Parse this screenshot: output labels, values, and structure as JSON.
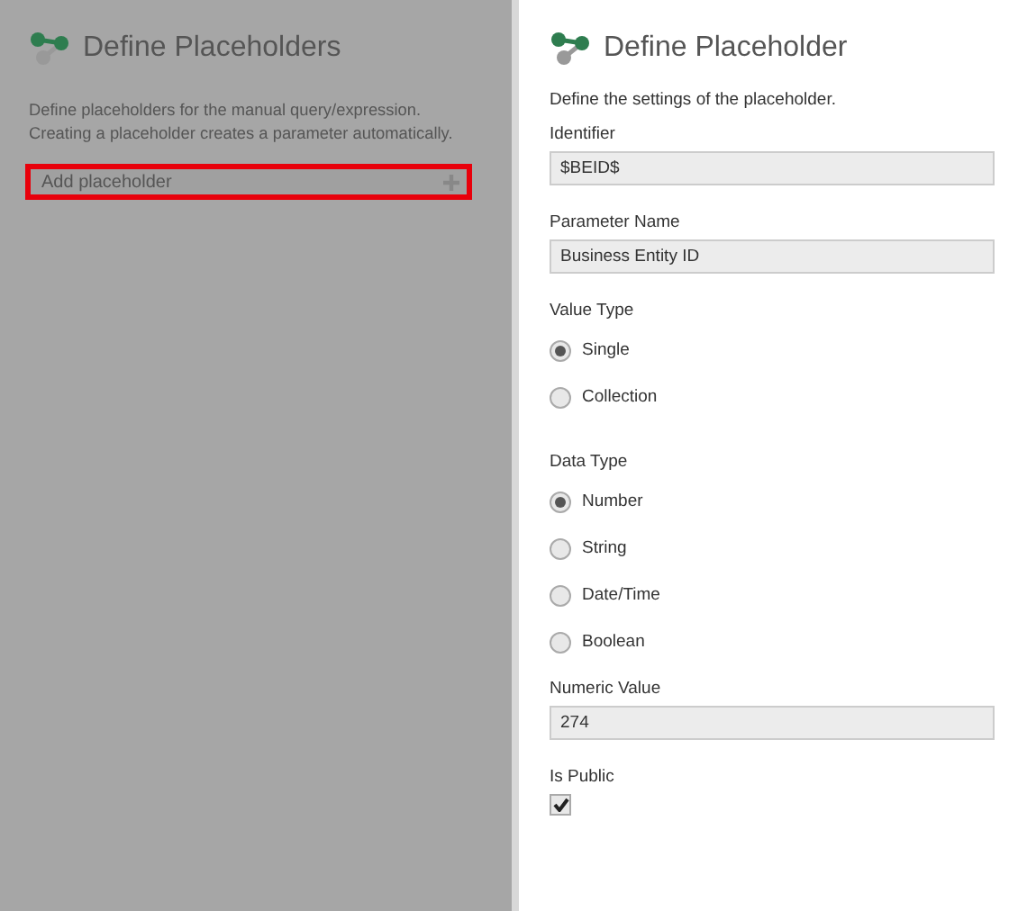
{
  "left_panel": {
    "title": "Define Placeholders",
    "dimmed": true,
    "description_lines": [
      "Define placeholders for the manual query/expression.",
      "Creating a placeholder creates a parameter automatically."
    ],
    "add_button": {
      "label": "Add placeholder",
      "highlighted": true
    }
  },
  "right_panel": {
    "title": "Define Placeholder",
    "description": "Define the settings of the placeholder.",
    "fields": [
      {
        "kind": "text",
        "label": "Identifier",
        "value": "$BEID$"
      },
      {
        "kind": "text",
        "label": "Parameter Name",
        "value": "Business Entity ID"
      },
      {
        "kind": "radio",
        "label": "Value Type",
        "options": [
          {
            "label": "Single",
            "selected": true
          },
          {
            "label": "Collection",
            "selected": false
          }
        ]
      },
      {
        "kind": "radio",
        "label": "Data Type",
        "options": [
          {
            "label": "Number",
            "selected": true
          },
          {
            "label": "String",
            "selected": false
          },
          {
            "label": "Date/Time",
            "selected": false
          },
          {
            "label": "Boolean",
            "selected": false
          }
        ]
      },
      {
        "kind": "text",
        "label": "Numeric Value",
        "value": "274"
      },
      {
        "kind": "checkbox",
        "label": "Is Public",
        "checked": true
      }
    ]
  }
}
